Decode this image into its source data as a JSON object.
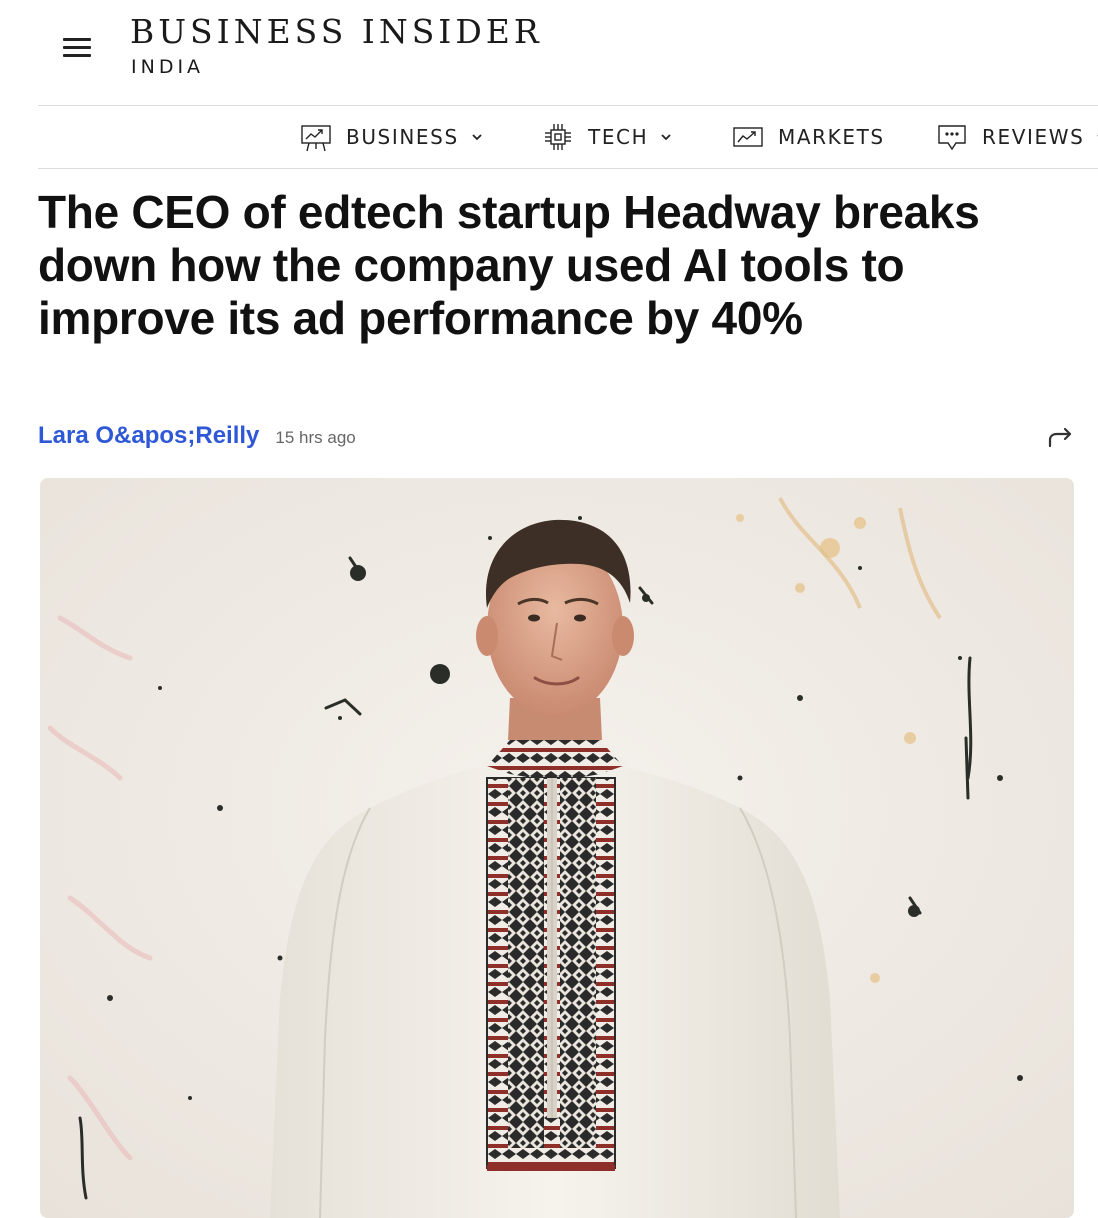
{
  "header": {
    "logo_main": "BUSINESS INSIDER",
    "logo_sub": "INDIA"
  },
  "nav": {
    "items": [
      {
        "label": "BUSINESS",
        "icon": "presentation-chart-icon",
        "has_dropdown": true
      },
      {
        "label": "TECH",
        "icon": "chip-icon",
        "has_dropdown": true
      },
      {
        "label": "MARKETS",
        "icon": "trend-chart-icon",
        "has_dropdown": false
      },
      {
        "label": "REVIEWS",
        "icon": "speech-bubble-icon",
        "has_dropdown": true
      }
    ]
  },
  "article": {
    "headline": "The CEO of edtech startup Headway breaks down how the company used AI tools to improve its ad performance by 40%",
    "author": "Lara O&apos;Reilly",
    "time": "15 hrs ago",
    "image": {
      "subject": "man in white embroidered shirt against paint-splattered wall",
      "colors": {
        "background": "#eee9e2",
        "shirt": "#f4f1ea",
        "embroidery": "#1e1e1e",
        "accent_red": "#a3312b"
      }
    }
  },
  "colors": {
    "author_link": "#2f58d6",
    "divider": "#dcdcdc",
    "text": "#111111"
  }
}
